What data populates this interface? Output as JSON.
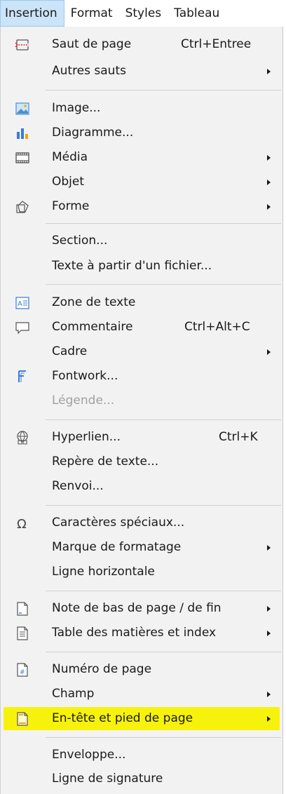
{
  "menubar": {
    "items": [
      "Insertion",
      "Format",
      "Styles",
      "Tableau"
    ]
  },
  "menu": {
    "items": [
      {
        "label": "Saut de page",
        "shortcut": "Ctrl+Entree",
        "icon": "page-break-icon"
      },
      {
        "label": "Autres sauts",
        "submenu": true
      },
      {
        "label": "Image...",
        "icon": "image-icon"
      },
      {
        "label": "Diagramme...",
        "icon": "chart-icon"
      },
      {
        "label": "Média",
        "submenu": true,
        "icon": "media-icon"
      },
      {
        "label": "Objet",
        "submenu": true
      },
      {
        "label": "Forme",
        "submenu": true,
        "icon": "shape-icon"
      },
      {
        "label": "Section..."
      },
      {
        "label": "Texte à partir d'un fichier..."
      },
      {
        "label": "Zone de texte",
        "icon": "text-box-icon"
      },
      {
        "label": "Commentaire",
        "shortcut": "Ctrl+Alt+C",
        "icon": "comment-icon"
      },
      {
        "label": "Cadre",
        "submenu": true
      },
      {
        "label": "Fontwork...",
        "icon": "fontwork-icon"
      },
      {
        "label": "Légende...",
        "disabled": true
      },
      {
        "label": "Hyperlien...",
        "shortcut": "Ctrl+K",
        "icon": "hyperlink-icon"
      },
      {
        "label": "Repère de texte..."
      },
      {
        "label": "Renvoi..."
      },
      {
        "label": "Caractères spéciaux...",
        "icon": "omega-icon"
      },
      {
        "label": "Marque de formatage",
        "submenu": true
      },
      {
        "label": "Ligne horizontale"
      },
      {
        "label": "Note de bas de page / de fin",
        "submenu": true,
        "icon": "footnote-icon"
      },
      {
        "label": "Table des matières et index",
        "submenu": true,
        "icon": "toc-icon"
      },
      {
        "label": "Numéro de page",
        "icon": "page-number-icon"
      },
      {
        "label": "Champ",
        "submenu": true
      },
      {
        "label": "En-tête et pied de page",
        "submenu": true,
        "highlighted": true,
        "icon": "header-footer-icon"
      },
      {
        "label": "Enveloppe..."
      },
      {
        "label": "Ligne de signature"
      }
    ]
  },
  "colors": {
    "highlight": "#f7f20c",
    "active_menu_bg": "#cce4f7",
    "menu_bg": "#f2f2f2",
    "disabled_text": "#a0a0a0",
    "icon_blue": "#3a7bd5"
  }
}
